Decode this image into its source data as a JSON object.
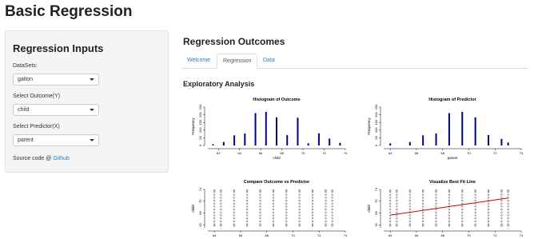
{
  "app": {
    "title": "Basic Regression"
  },
  "sidebar": {
    "title": "Regression Inputs",
    "dataset_label": "DataSets:",
    "dataset_value": "galton",
    "outcome_label": "Select Outcome(Y)",
    "outcome_value": "child",
    "predictor_label": "Select Predictor(X)",
    "predictor_value": "parent",
    "source_prefix": "Source code @",
    "source_link": "Github"
  },
  "main": {
    "title": "Regression Outcomes",
    "tabs": [
      {
        "label": "Welcome"
      },
      {
        "label": "Regression"
      },
      {
        "label": "Data"
      }
    ],
    "active_tab": "Regression",
    "section_title": "Exploratory Analysis"
  },
  "chart_data": [
    {
      "type": "bar",
      "title": "Histogram of Outcome",
      "xlabel": "child",
      "ylabel": "Frequency",
      "x": [
        61.5,
        62.5,
        63.5,
        64.5,
        65.5,
        66.5,
        67.5,
        68.5,
        69.5,
        70.5,
        71.5,
        72.5,
        73.5
      ],
      "values": [
        8,
        23,
        66,
        78,
        211,
        219,
        183,
        68,
        181,
        14,
        79,
        45,
        17
      ],
      "xlim": [
        61,
        74
      ],
      "ylim": [
        0,
        250
      ],
      "xticks": [
        "62",
        "64",
        "66",
        "68",
        "70",
        "72",
        "74"
      ],
      "yticks": [
        "0",
        "50",
        "100",
        "150",
        "200",
        "250"
      ]
    },
    {
      "type": "bar",
      "title": "Histogram of Predictor",
      "xlabel": "parent",
      "ylabel": "Frequency",
      "x": [
        64,
        65.5,
        66.5,
        67.5,
        68.5,
        69.5,
        70.5,
        71.5,
        72.5,
        73
      ],
      "values": [
        14,
        23,
        66,
        78,
        211,
        219,
        183,
        68,
        43,
        19
      ],
      "xlim": [
        63.5,
        74
      ],
      "ylim": [
        0,
        250
      ],
      "xticks": [
        "64",
        "66",
        "68",
        "70",
        "72",
        "74"
      ],
      "yticks": [
        "0",
        "50",
        "100",
        "150",
        "200",
        "250"
      ]
    },
    {
      "type": "scatter",
      "title": "Compare Outcome vs Predictor",
      "xlabel": "parent",
      "ylabel": "child",
      "marker": "o",
      "x_levels": [
        64,
        64.5,
        65.5,
        66.5,
        67.5,
        68.5,
        69.5,
        70.5,
        71.5,
        72.5,
        73
      ],
      "y_levels": [
        61.7,
        62.2,
        63.2,
        64.2,
        65.2,
        66.2,
        67.2,
        68.2,
        69.2,
        70.2,
        71.2,
        72.2,
        73.2,
        73.7
      ],
      "xlim": [
        63.5,
        74
      ],
      "ylim": [
        61,
        74
      ],
      "xticks": [
        "64",
        "66",
        "68",
        "70",
        "72",
        "74"
      ],
      "yticks": [
        "62",
        "66",
        "70",
        "74"
      ]
    },
    {
      "type": "scatter",
      "title": "Visualize Best Fit Line",
      "xlabel": "parent",
      "ylabel": "child",
      "marker": "o",
      "x_levels": [
        64,
        64.5,
        65.5,
        66.5,
        67.5,
        68.5,
        69.5,
        70.5,
        71.5,
        72.5,
        73
      ],
      "y_levels": [
        61.7,
        62.2,
        63.2,
        64.2,
        65.2,
        66.2,
        67.2,
        68.2,
        69.2,
        70.2,
        71.2,
        72.2,
        73.2,
        73.7
      ],
      "fit_line": {
        "intercept": 23.94,
        "slope": 0.646,
        "color": "#cc0000"
      },
      "xlim": [
        63.5,
        74
      ],
      "ylim": [
        61,
        74
      ],
      "xticks": [
        "64",
        "66",
        "68",
        "70",
        "72",
        "74"
      ],
      "yticks": [
        "62",
        "66",
        "70",
        "74"
      ]
    }
  ],
  "colors": {
    "bar": "#00008b",
    "link": "#337ab7",
    "fit_line": "#cc0000",
    "well": "#f5f5f5"
  }
}
